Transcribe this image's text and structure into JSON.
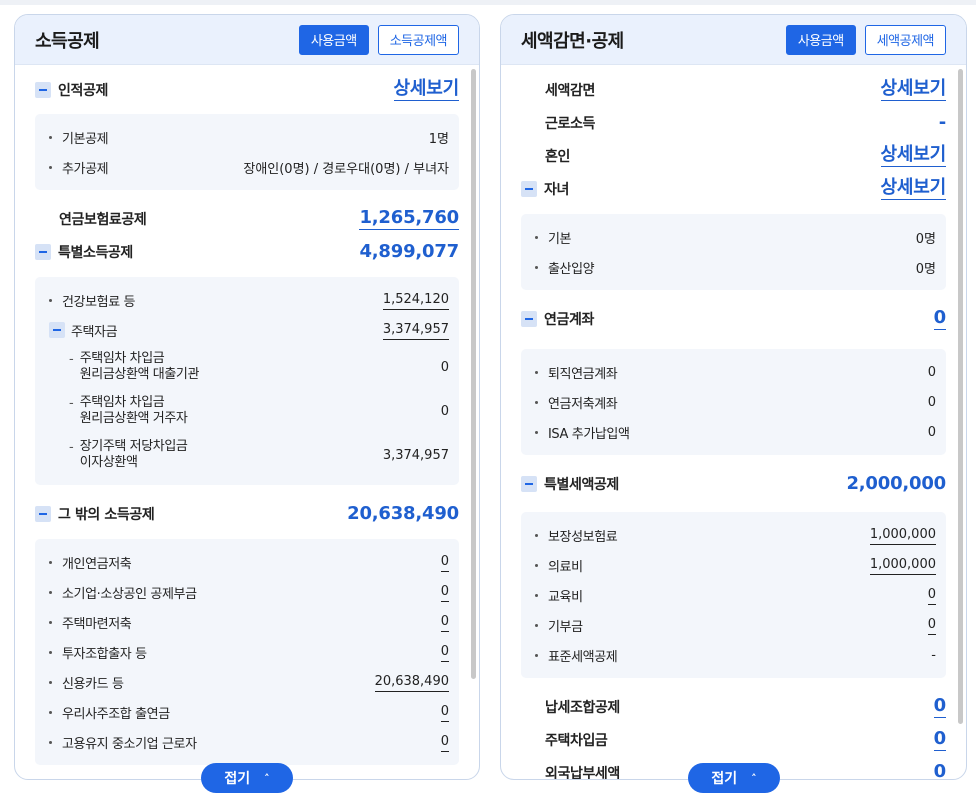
{
  "left": {
    "title": "소득공제",
    "btn_used": "사용금액",
    "btn_deduct": "소득공제액",
    "personal": {
      "label": "인적공제",
      "value": "상세보기",
      "items": [
        {
          "label": "기본공제",
          "value": "1명"
        },
        {
          "label": "추가공제",
          "value": "장애인(0명) / 경로우대(0명) / 부녀자"
        }
      ]
    },
    "pension": {
      "label": "연금보험료공제",
      "value": "1,265,760"
    },
    "special": {
      "label": "특별소득공제",
      "value": "4,899,077",
      "health": {
        "label": "건강보험료 등",
        "value": "1,524,120"
      },
      "housing": {
        "label": "주택자금",
        "value": "3,374,957"
      },
      "housing_items": [
        {
          "line1": "주택임차 차입금",
          "line2": "원리금상환액 대출기관",
          "value": "0"
        },
        {
          "line1": "주택임차 차입금",
          "line2": "원리금상환액 거주자",
          "value": "0"
        },
        {
          "line1": "장기주택 저당차입금",
          "line2": "이자상환액",
          "value": "3,374,957"
        }
      ]
    },
    "other": {
      "label": "그 밖의 소득공제",
      "value": "20,638,490",
      "items": [
        {
          "label": "개인연금저축",
          "value": "0"
        },
        {
          "label": "소기업·소상공인 공제부금",
          "value": "0"
        },
        {
          "label": "주택마련저축",
          "value": "0"
        },
        {
          "label": "투자조합출자 등",
          "value": "0"
        },
        {
          "label": "신용카드 등",
          "value": "20,638,490"
        },
        {
          "label": "우리사주조합 출연금",
          "value": "0"
        },
        {
          "label": "고용유지 중소기업 근로자",
          "value": "0"
        }
      ]
    },
    "fold": "접기"
  },
  "right": {
    "title": "세액감면·공제",
    "btn_used": "사용금액",
    "btn_credit": "세액공제액",
    "reduction": {
      "label": "세액감면",
      "value": "상세보기"
    },
    "earned": {
      "label": "근로소득",
      "value": "-"
    },
    "marriage": {
      "label": "혼인",
      "value": "상세보기"
    },
    "children": {
      "label": "자녀",
      "value": "상세보기",
      "items": [
        {
          "label": "기본",
          "value": "0명"
        },
        {
          "label": "출산입양",
          "value": "0명"
        }
      ]
    },
    "pension_acct": {
      "label": "연금계좌",
      "value": "0",
      "items": [
        {
          "label": "퇴직연금계좌",
          "value": "0"
        },
        {
          "label": "연금저축계좌",
          "value": "0"
        },
        {
          "label": "ISA 추가납입액",
          "value": "0"
        }
      ]
    },
    "special_credit": {
      "label": "특별세액공제",
      "value": "2,000,000",
      "items": [
        {
          "label": "보장성보험료",
          "value": "1,000,000"
        },
        {
          "label": "의료비",
          "value": "1,000,000"
        },
        {
          "label": "교육비",
          "value": "0"
        },
        {
          "label": "기부금",
          "value": "0"
        },
        {
          "label": "표준세액공제",
          "value": "-"
        }
      ]
    },
    "union": {
      "label": "납세조합공제",
      "value": "0"
    },
    "housing_loan": {
      "label": "주택차입금",
      "value": "0"
    },
    "foreign_tax": {
      "label": "외국납부세액",
      "value": "0"
    },
    "fold": "접기"
  }
}
